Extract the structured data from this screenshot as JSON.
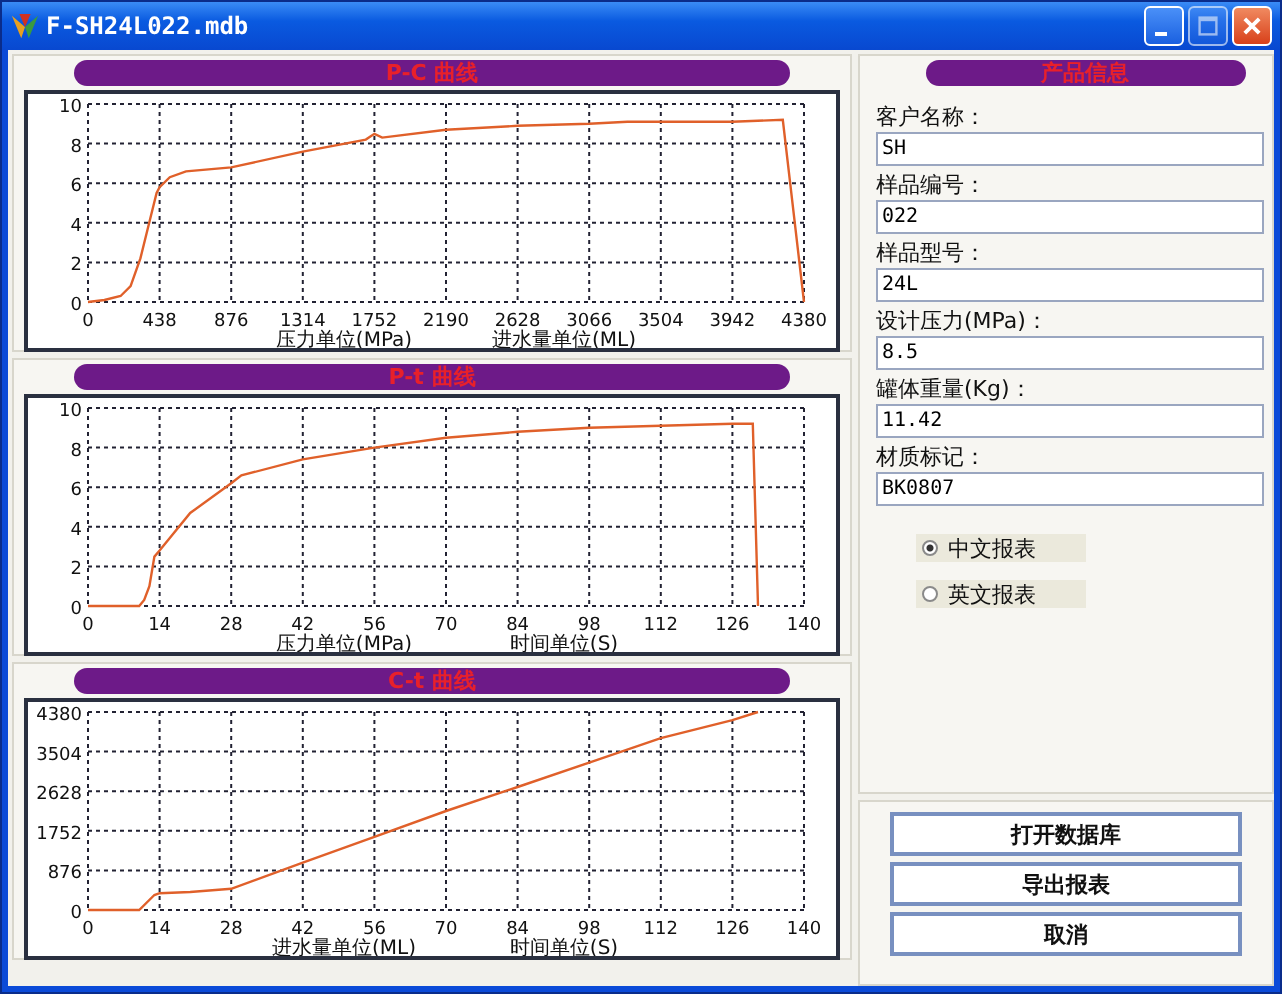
{
  "window": {
    "title": "F-SH24L022.mdb"
  },
  "charts": [
    {
      "axis_units": [
        "压力单位(MPa)",
        "进水量单位(ML)"
      ],
      "chart_data": {
        "type": "line",
        "title": "P-C 曲线",
        "grid": true,
        "xlim": [
          0,
          4380
        ],
        "ylim": [
          0,
          10
        ],
        "xticks": [
          0,
          438,
          876,
          1314,
          1752,
          2190,
          2628,
          3066,
          3504,
          3942,
          4380
        ],
        "yticks": [
          0,
          2,
          4,
          6,
          8,
          10
        ],
        "x": [
          0,
          100,
          200,
          260,
          320,
          380,
          420,
          438,
          500,
          600,
          876,
          1314,
          1700,
          1752,
          1800,
          2190,
          2628,
          3066,
          3300,
          3504,
          3942,
          4250,
          4380
        ],
        "values": [
          0,
          0.1,
          0.3,
          0.8,
          2.2,
          4.2,
          5.5,
          5.8,
          6.3,
          6.6,
          6.8,
          7.6,
          8.2,
          8.5,
          8.3,
          8.7,
          8.9,
          9.0,
          9.1,
          9.1,
          9.1,
          9.2,
          0
        ]
      }
    },
    {
      "axis_units": [
        "压力单位(MPa)",
        "时间单位(S)"
      ],
      "chart_data": {
        "type": "line",
        "title": "P-t 曲线",
        "grid": true,
        "xlim": [
          0,
          140
        ],
        "ylim": [
          0,
          10
        ],
        "xticks": [
          0,
          14,
          28,
          42,
          56,
          70,
          84,
          98,
          112,
          126,
          140
        ],
        "yticks": [
          0,
          2,
          4,
          6,
          8,
          10
        ],
        "x": [
          0,
          10,
          11,
          12,
          13,
          14,
          20,
          28,
          30,
          42,
          56,
          70,
          84,
          98,
          112,
          126,
          130,
          131
        ],
        "values": [
          0,
          0,
          0.3,
          1,
          2.5,
          2.8,
          4.7,
          6.2,
          6.6,
          7.4,
          8.0,
          8.5,
          8.8,
          9.0,
          9.1,
          9.2,
          9.2,
          0
        ]
      }
    },
    {
      "axis_units": [
        "进水量单位(ML)",
        "时间单位(S)"
      ],
      "chart_data": {
        "type": "line",
        "title": "C-t 曲线",
        "grid": true,
        "xlim": [
          0,
          140
        ],
        "ylim": [
          0,
          4380
        ],
        "xticks": [
          0,
          14,
          28,
          42,
          56,
          70,
          84,
          98,
          112,
          126,
          140
        ],
        "yticks": [
          0,
          876,
          1752,
          2628,
          3504,
          4380
        ],
        "x": [
          0,
          10,
          13,
          14,
          20,
          28,
          42,
          56,
          70,
          84,
          98,
          112,
          126,
          131
        ],
        "values": [
          0,
          0,
          330,
          370,
          400,
          470,
          1050,
          1620,
          2190,
          2720,
          3260,
          3800,
          4200,
          4380
        ]
      }
    }
  ],
  "product_info": {
    "title": "产品信息",
    "fields": [
      {
        "label": "客户名称：",
        "value": "SH"
      },
      {
        "label": "样品编号：",
        "value": "022"
      },
      {
        "label": "样品型号：",
        "value": "24L"
      },
      {
        "label": "设计压力(MPa)：",
        "value": "8.5"
      },
      {
        "label": "罐体重量(Kg)：",
        "value": "11.42"
      },
      {
        "label": "材质标记：",
        "value": "BK0807"
      }
    ]
  },
  "report_language": [
    {
      "label": "中文报表",
      "selected": true
    },
    {
      "label": "英文报表",
      "selected": false
    }
  ],
  "buttons": [
    "打开数据库",
    "导出报表",
    "取消"
  ]
}
